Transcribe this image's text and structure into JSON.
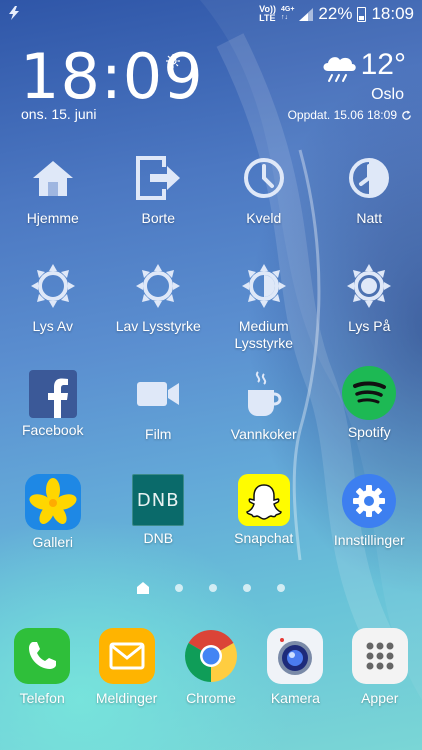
{
  "status_bar": {
    "left_icon": "flash-icon",
    "volte_top": "Vo))",
    "volte_bottom": "LTE",
    "network_top": "4G+",
    "network_bottom": "↑↓",
    "battery_percent": "22%",
    "time": "18:09"
  },
  "clock_widget": {
    "time": "18:09",
    "date": "ons. 15. juni",
    "alarm_icon": "alarm-icon"
  },
  "weather_widget": {
    "temperature": "12°",
    "city": "Oslo",
    "updated": "Oppdat. 15.06 18:09",
    "condition_icon": "rain-cloud-icon"
  },
  "rows": [
    [
      {
        "label": "Hjemme",
        "icon": "home-icon"
      },
      {
        "label": "Borte",
        "icon": "exit-icon"
      },
      {
        "label": "Kveld",
        "icon": "clock-icon"
      },
      {
        "label": "Natt",
        "icon": "clock-half-icon"
      }
    ],
    [
      {
        "label": "Lys Av",
        "icon": "brightness-off-icon"
      },
      {
        "label": "Lav Lysstyrke",
        "icon": "brightness-low-icon"
      },
      {
        "label": "Medium\nLysstyrke",
        "icon": "brightness-medium-icon"
      },
      {
        "label": "Lys På",
        "icon": "brightness-full-icon"
      }
    ],
    [
      {
        "label": "Facebook",
        "icon": "facebook-icon",
        "color": "#3b5998"
      },
      {
        "label": "Film",
        "icon": "video-camera-icon"
      },
      {
        "label": "Vannkoker",
        "icon": "coffee-cup-icon"
      },
      {
        "label": "Spotify",
        "icon": "spotify-icon",
        "color": "#1db954"
      }
    ],
    [
      {
        "label": "Galleri",
        "icon": "gallery-icon",
        "color": "#1e88e5"
      },
      {
        "label": "DNB",
        "icon": "dnb-icon",
        "color": "#0a6a6a"
      },
      {
        "label": "Snapchat",
        "icon": "snapchat-icon",
        "color": "#fffc00"
      },
      {
        "label": "Innstillinger",
        "icon": "settings-gear-icon",
        "color": "#3d7ff0"
      }
    ]
  ],
  "page_indicator": {
    "pages": 5,
    "current": 1
  },
  "dock": [
    {
      "label": "Telefon",
      "icon": "phone-icon",
      "color": "#2fbf3a"
    },
    {
      "label": "Meldinger",
      "icon": "messages-icon",
      "color": "#ffb400"
    },
    {
      "label": "Chrome",
      "icon": "chrome-icon"
    },
    {
      "label": "Kamera",
      "icon": "camera-icon"
    },
    {
      "label": "Apper",
      "icon": "apps-grid-icon"
    }
  ],
  "dnb_logo_text": "DNB"
}
